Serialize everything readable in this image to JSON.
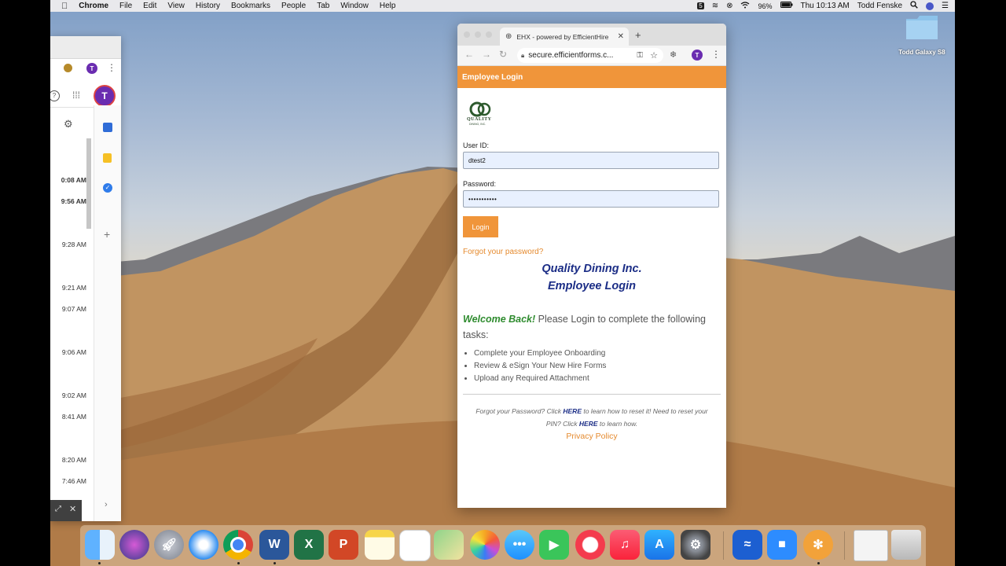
{
  "menubar": {
    "app": "Chrome",
    "items": [
      "File",
      "Edit",
      "View",
      "History",
      "Bookmarks",
      "People",
      "Tab",
      "Window",
      "Help"
    ],
    "battery": "96%",
    "clock": "Thu 10:13 AM",
    "user": "Todd Fenske"
  },
  "desktop": {
    "folder_label": "Todd Galaxy S8"
  },
  "left_window": {
    "avatar_letter": "T",
    "times": [
      "0:08 AM",
      "9:56 AM",
      "9:28 AM",
      "9:21 AM",
      "9:07 AM",
      "9:06 AM",
      "9:02 AM",
      "8:41 AM",
      "8:20 AM",
      "7:46 AM"
    ]
  },
  "browser": {
    "tab_title": "EHX - powered by EfficientHire",
    "url": "secure.efficientforms.c...",
    "profile_letter": "T"
  },
  "page": {
    "header": "Employee Login",
    "logo_text": "QUALITY",
    "logo_sub": "DINING, INC.",
    "user_id_label": "User ID:",
    "user_id_value": "dtest2",
    "password_label": "Password:",
    "password_value": "•••••••••••",
    "login_button": "Login",
    "forgot_link": "Forgot your password?",
    "title_line1": "Quality Dining Inc.",
    "title_line2": "Employee Login",
    "welcome_bold": "Welcome Back!",
    "welcome_text": " Please Login to complete the following tasks:",
    "tasks": [
      "Complete your Employee Onboarding",
      "Review & eSign Your New Hire Forms",
      "Upload any Required Attachment"
    ],
    "footer_a": "Forgot your Password? Click ",
    "footer_here1": "HERE",
    "footer_b": " to learn how to reset it! Need to reset your PIN? Click ",
    "footer_here2": "HERE",
    "footer_c": " to learn how.",
    "privacy": "Privacy Policy"
  },
  "colors": {
    "accent_orange": "#f0953a",
    "navy": "#1b2d86",
    "welcome_green": "#2e8b2e"
  },
  "dock": {
    "icons": [
      "finder-icon",
      "siri-icon",
      "launchpad-icon",
      "safari-icon",
      "chrome-icon",
      "word-icon",
      "excel-icon",
      "powerpoint-icon",
      "notes-icon",
      "reminders-icon",
      "maps-icon",
      "photos-icon",
      "messages-icon",
      "facetime-icon",
      "news-icon",
      "music-icon",
      "app-store-icon",
      "system-preferences-icon",
      "teamviewer-icon",
      "zoom-icon",
      "misc-icon",
      "document-icon",
      "trash-icon"
    ]
  }
}
